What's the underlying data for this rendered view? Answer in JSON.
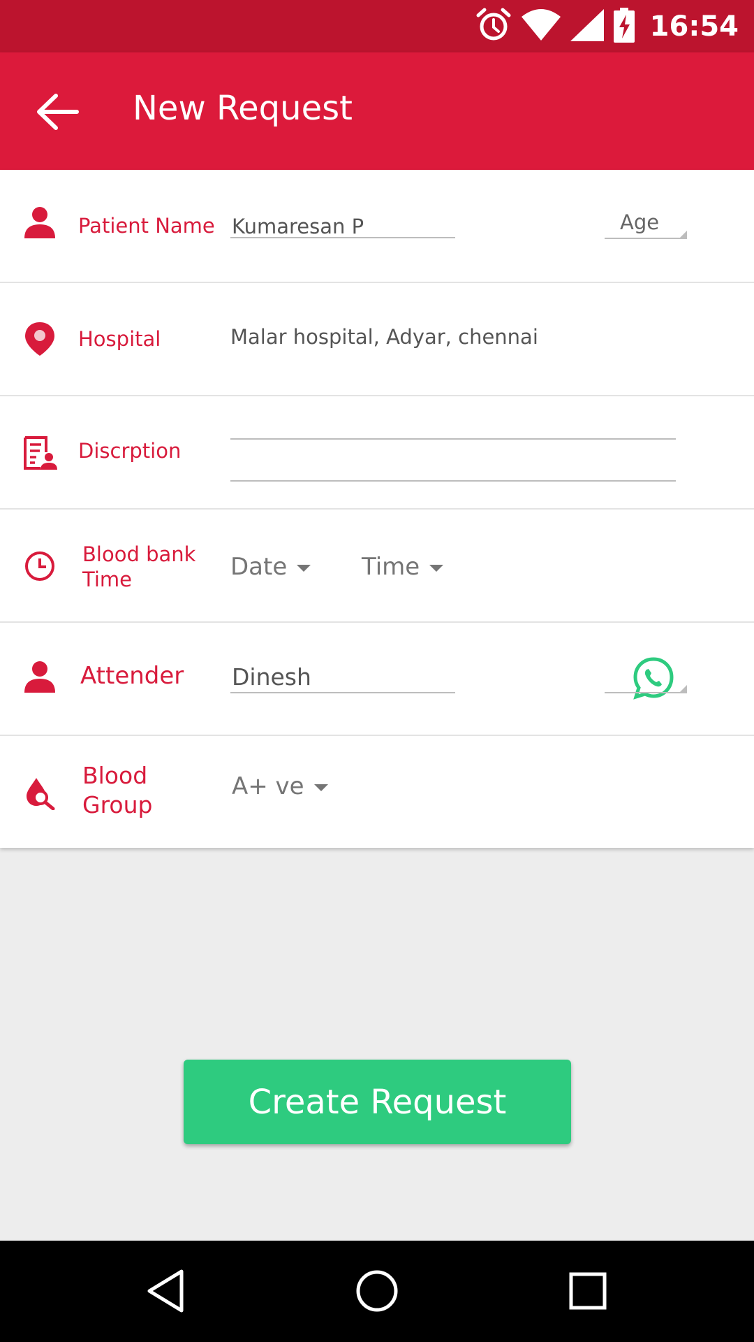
{
  "status_bar": {
    "time": "16:54",
    "icons": [
      "alarm-icon",
      "wifi-icon",
      "signal-icon",
      "battery-charging-icon"
    ]
  },
  "app_bar": {
    "title": "New Request",
    "back_icon": "arrow-back-icon"
  },
  "form": {
    "patient": {
      "label": "Patient Name",
      "value": "Kumaresan P",
      "age_placeholder": "Age",
      "icon": "person-icon"
    },
    "hospital": {
      "label": "Hospital",
      "value": "Malar hospital, Adyar, chennai",
      "icon": "location-pin-icon"
    },
    "description": {
      "label": "Discrption",
      "value": "",
      "icon": "document-person-icon"
    },
    "blood_bank_time": {
      "label_line1": "Blood bank",
      "label_line2": "Time",
      "date": "Date",
      "time": "Time",
      "icon": "clock-icon"
    },
    "attender": {
      "label": "Attender",
      "value": "Dinesh",
      "icon": "person-icon",
      "contact_icon": "whatsapp-icon"
    },
    "blood_group": {
      "label_line1": "Blood",
      "label_line2": "Group",
      "value": "A+ ve",
      "icon": "blood-drop-search-icon"
    }
  },
  "create_button": {
    "label": "Create Request"
  },
  "colors": {
    "primary": "#dc1a3b",
    "status_bar": "#bc142e",
    "accent_green": "#2ecb7f",
    "label_red": "#d81b3c"
  }
}
